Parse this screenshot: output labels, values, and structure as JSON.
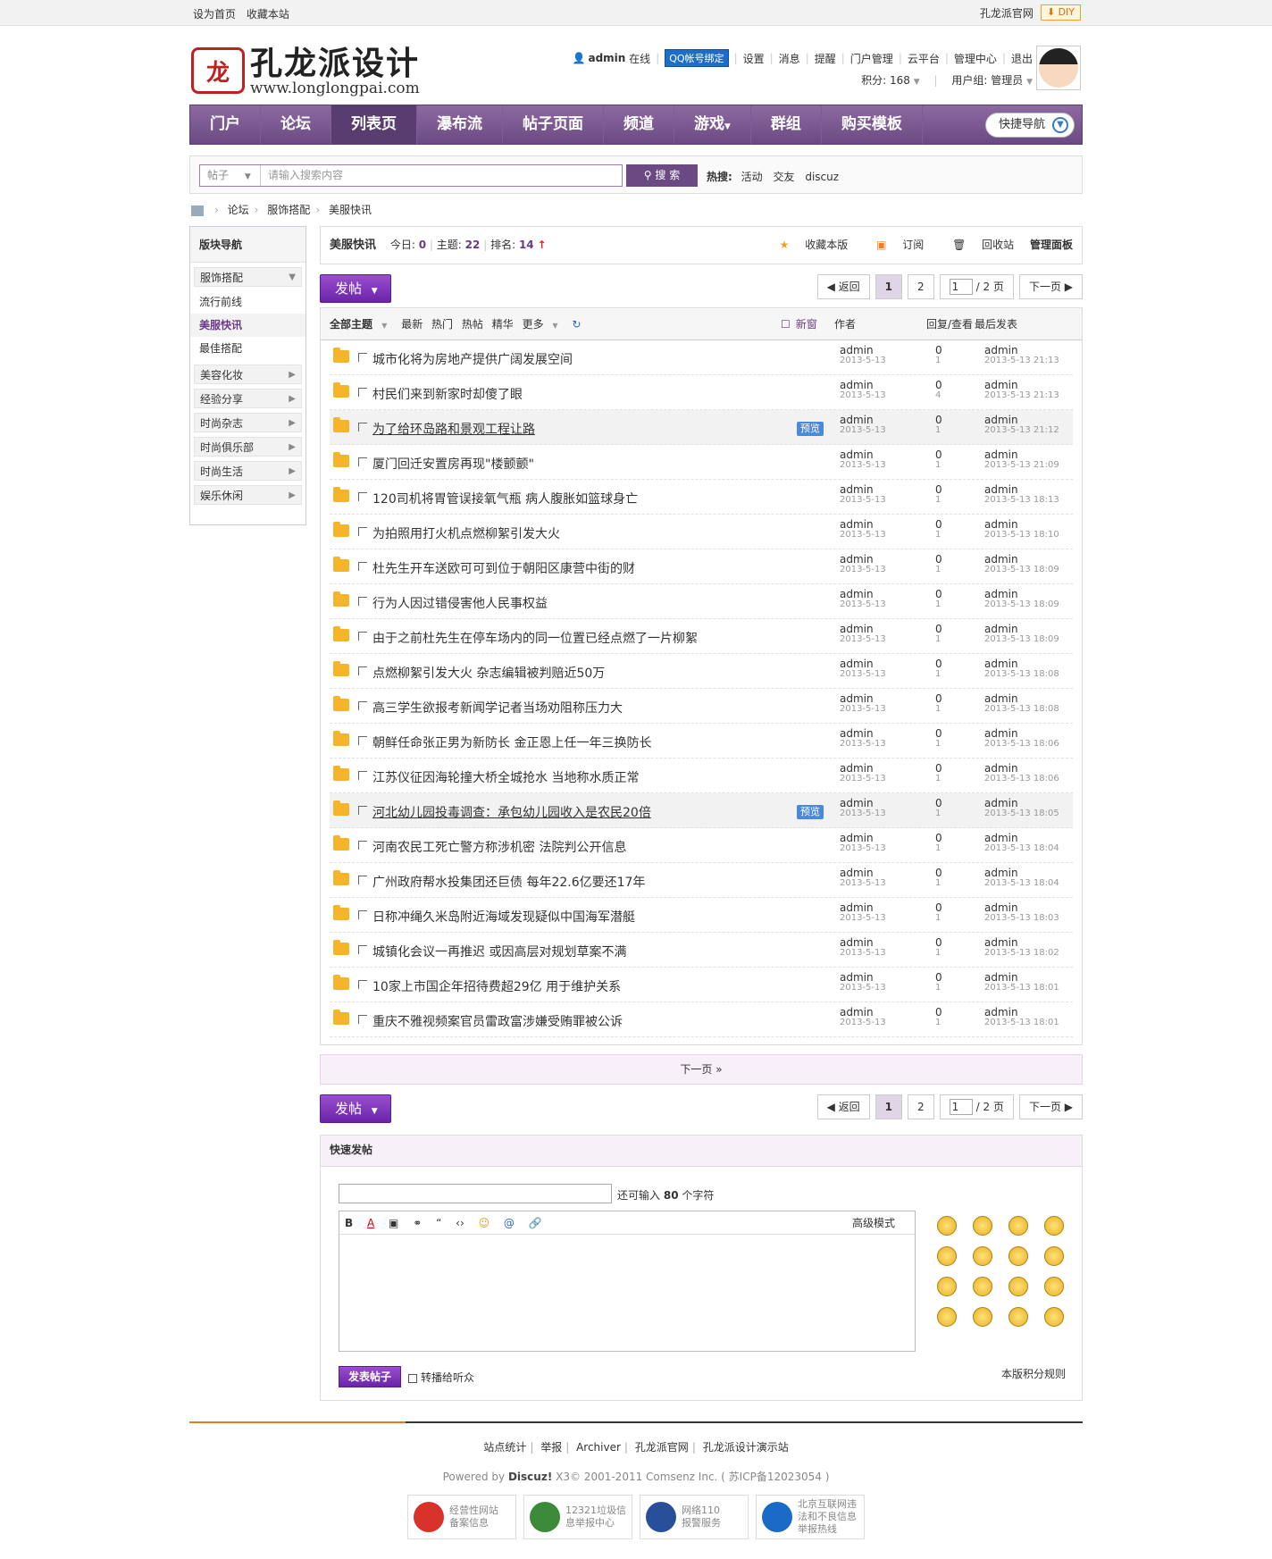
{
  "topbar": {
    "left": [
      "设为首页",
      "收藏本站"
    ],
    "site": "孔龙派官网",
    "diy": "DIY"
  },
  "logo": {
    "seal": "龙",
    "cn": "孔龙派设计",
    "url": "www.longlongpai.com"
  },
  "user": {
    "name": "admin",
    "status": "在线",
    "qq": "QQ帐号绑定",
    "menu": [
      "设置",
      "消息",
      "提醒",
      "门户管理",
      "云平台",
      "管理中心",
      "退出"
    ],
    "points": "积分: 168",
    "group": "用户组: 管理员"
  },
  "nav": {
    "items": [
      "门户",
      "论坛",
      "列表页",
      "瀑布流",
      "帖子页面",
      "频道",
      "游戏",
      "群组",
      "购买模板"
    ],
    "quick": "快捷导航"
  },
  "search": {
    "type": "帖子",
    "placeholder": "请输入搜索内容",
    "button": "搜 索",
    "hot_label": "热搜:",
    "hot": [
      "活动",
      "交友",
      "discuz"
    ]
  },
  "crumb": [
    "论坛",
    "服饰搭配",
    "美服快讯"
  ],
  "sidebar": {
    "title": "版块导航",
    "cats": [
      "服饰搭配",
      "美容化妆",
      "经验分享",
      "时尚杂志",
      "时尚俱乐部",
      "时尚生活",
      "娱乐休闲"
    ],
    "subs": [
      "流行前线",
      "美服快讯",
      "最佳搭配"
    ]
  },
  "forum": {
    "name": "美服快讯",
    "today_label": "今日:",
    "today": "0",
    "topics_label": "主题:",
    "topics": "22",
    "rank_label": "排名:",
    "rank": "14",
    "actions": [
      "收藏本版",
      "订阅",
      "回收站",
      "管理面板"
    ]
  },
  "post_btn": "发帖",
  "pager": {
    "back": "返回",
    "pages": [
      "1",
      "2"
    ],
    "input": "1",
    "total": "/ 2 页",
    "next": "下一页"
  },
  "thead": {
    "all": "全部主题",
    "filters": [
      "最新",
      "热门",
      "热帖",
      "精华",
      "更多"
    ],
    "new_win": "新窗",
    "author": "作者",
    "reply": "回复/查看",
    "last": "最后发表"
  },
  "threads": [
    {
      "t": "城市化将为房地产提供广阔发展空间",
      "a": "admin",
      "d": "2013-5-13",
      "r": "0",
      "v": "1",
      "lu": "admin",
      "lt": "2013-5-13 21:13",
      "pv": ""
    },
    {
      "t": "村民们来到新家时却傻了眼",
      "a": "admin",
      "d": "2013-5-13",
      "r": "0",
      "v": "4",
      "lu": "admin",
      "lt": "2013-5-13 21:13",
      "pv": ""
    },
    {
      "t": "为了给环岛路和景观工程让路",
      "a": "admin",
      "d": "2013-5-13",
      "r": "0",
      "v": "1",
      "lu": "admin",
      "lt": "2013-5-13 21:12",
      "pv": "预览"
    },
    {
      "t": "厦门回迁安置房再现\"楼颤颤\"",
      "a": "admin",
      "d": "2013-5-13",
      "r": "0",
      "v": "1",
      "lu": "admin",
      "lt": "2013-5-13 21:09",
      "pv": ""
    },
    {
      "t": "120司机将胃管误接氧气瓶 病人腹胀如篮球身亡",
      "a": "admin",
      "d": "2013-5-13",
      "r": "0",
      "v": "1",
      "lu": "admin",
      "lt": "2013-5-13 18:13",
      "pv": ""
    },
    {
      "t": "为拍照用打火机点燃柳絮引发大火",
      "a": "admin",
      "d": "2013-5-13",
      "r": "0",
      "v": "1",
      "lu": "admin",
      "lt": "2013-5-13 18:10",
      "pv": ""
    },
    {
      "t": "杜先生开车送欧可可到位于朝阳区康营中街的财",
      "a": "admin",
      "d": "2013-5-13",
      "r": "0",
      "v": "1",
      "lu": "admin",
      "lt": "2013-5-13 18:09",
      "pv": ""
    },
    {
      "t": "行为人因过错侵害他人民事权益",
      "a": "admin",
      "d": "2013-5-13",
      "r": "0",
      "v": "1",
      "lu": "admin",
      "lt": "2013-5-13 18:09",
      "pv": ""
    },
    {
      "t": "由于之前杜先生在停车场内的同一位置已经点燃了一片柳絮",
      "a": "admin",
      "d": "2013-5-13",
      "r": "0",
      "v": "1",
      "lu": "admin",
      "lt": "2013-5-13 18:09",
      "pv": ""
    },
    {
      "t": "点燃柳絮引发大火 杂志编辑被判赔近50万",
      "a": "admin",
      "d": "2013-5-13",
      "r": "0",
      "v": "1",
      "lu": "admin",
      "lt": "2013-5-13 18:08",
      "pv": ""
    },
    {
      "t": "高三学生欲报考新闻学记者当场劝阻称压力大",
      "a": "admin",
      "d": "2013-5-13",
      "r": "0",
      "v": "1",
      "lu": "admin",
      "lt": "2013-5-13 18:08",
      "pv": ""
    },
    {
      "t": "朝鲜任命张正男为新防长 金正恩上任一年三换防长",
      "a": "admin",
      "d": "2013-5-13",
      "r": "0",
      "v": "1",
      "lu": "admin",
      "lt": "2013-5-13 18:06",
      "pv": ""
    },
    {
      "t": "江苏仪征因海轮撞大桥全城抢水 当地称水质正常",
      "a": "admin",
      "d": "2013-5-13",
      "r": "0",
      "v": "1",
      "lu": "admin",
      "lt": "2013-5-13 18:06",
      "pv": ""
    },
    {
      "t": "河北幼儿园投毒调查：承包幼儿园收入是农民20倍",
      "a": "admin",
      "d": "2013-5-13",
      "r": "0",
      "v": "1",
      "lu": "admin",
      "lt": "2013-5-13 18:05",
      "pv": "预览"
    },
    {
      "t": "河南农民工死亡警方称涉机密 法院判公开信息",
      "a": "admin",
      "d": "2013-5-13",
      "r": "0",
      "v": "1",
      "lu": "admin",
      "lt": "2013-5-13 18:04",
      "pv": ""
    },
    {
      "t": "广州政府帮水投集团还巨债 每年22.6亿要还17年",
      "a": "admin",
      "d": "2013-5-13",
      "r": "0",
      "v": "1",
      "lu": "admin",
      "lt": "2013-5-13 18:04",
      "pv": ""
    },
    {
      "t": "日称冲绳久米岛附近海域发现疑似中国海军潜艇",
      "a": "admin",
      "d": "2013-5-13",
      "r": "0",
      "v": "1",
      "lu": "admin",
      "lt": "2013-5-13 18:03",
      "pv": ""
    },
    {
      "t": "城镇化会议一再推迟 或因高层对规划草案不满",
      "a": "admin",
      "d": "2013-5-13",
      "r": "0",
      "v": "1",
      "lu": "admin",
      "lt": "2013-5-13 18:02",
      "pv": ""
    },
    {
      "t": "10家上市国企年招待费超29亿 用于维护关系",
      "a": "admin",
      "d": "2013-5-13",
      "r": "0",
      "v": "1",
      "lu": "admin",
      "lt": "2013-5-13 18:01",
      "pv": ""
    },
    {
      "t": "重庆不雅视频案官员雷政富涉嫌受贿罪被公诉",
      "a": "admin",
      "d": "2013-5-13",
      "r": "0",
      "v": "1",
      "lu": "admin",
      "lt": "2013-5-13 18:01",
      "pv": ""
    }
  ],
  "next_bar": "下一页 »",
  "fast": {
    "title": "快速发帖",
    "remain_pre": "还可输入",
    "remain": "80",
    "remain_post": "个字符",
    "toolbar": [
      "B",
      "A",
      "▣",
      "⚭",
      "“",
      "‹›",
      "☺",
      "@",
      "🔗"
    ],
    "advanced": "高级模式",
    "submit": "发表帖子",
    "forward": "转播给听众",
    "rule": "本版积分规则"
  },
  "footer": {
    "links": [
      "站点统计",
      "举报",
      "Archiver",
      "孔龙派官网",
      "孔龙派设计演示站"
    ],
    "powered_pre": "Powered by",
    "discuz": "Discuz!",
    "powered_post": "X3© 2001-2011 Comsenz Inc.  ( 苏ICP备12023054 )",
    "badges": [
      {
        "l1": "经营性网站",
        "l2": "备案信息",
        "c": "#d8322a"
      },
      {
        "l1": "12321垃圾信",
        "l2": "息举报中心",
        "c": "#3a8a3a"
      },
      {
        "l1": "网络110",
        "l2": "报警服务",
        "c": "#2a4f9a"
      },
      {
        "l1": "北京互联网违",
        "l2": "法和不良信息",
        "l3": "举报热线",
        "c": "#1a6ac8"
      }
    ]
  }
}
